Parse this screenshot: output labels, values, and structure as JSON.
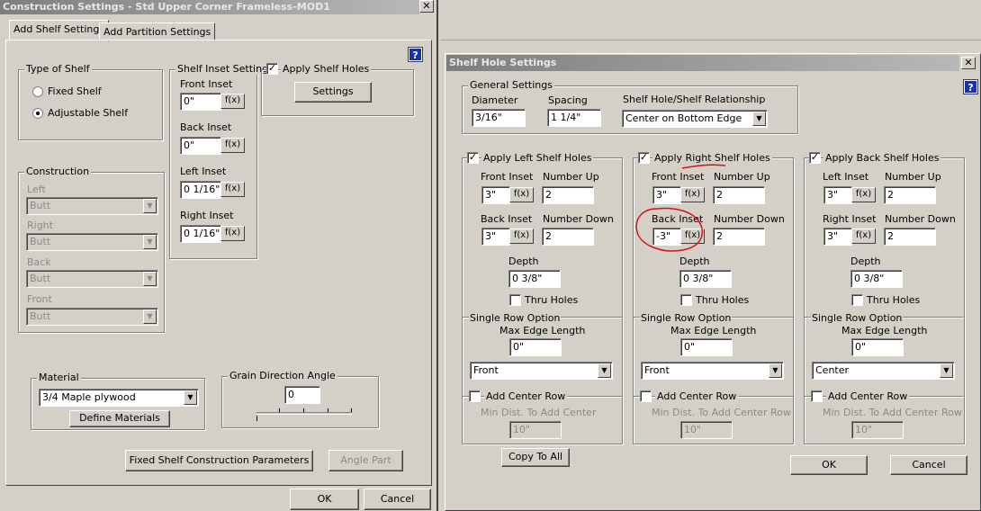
{
  "left_dialog": {
    "title": "Construction Settings - Std Upper Corner Frameless-MOD1",
    "tabs": [
      "Add Shelf Settings",
      "Add Partition Settings"
    ],
    "help": "?",
    "type_of_shelf": {
      "legend": "Type of Shelf",
      "fixed": "Fixed Shelf",
      "adjustable": "Adjustable Shelf",
      "selected": "Adjustable Shelf"
    },
    "shelf_inset": {
      "legend": "Shelf Inset Settings",
      "front_label": "Front Inset",
      "front_value": "0\"",
      "back_label": "Back Inset",
      "back_value": "0\"",
      "left_label": "Left Inset",
      "left_value": "0 1/16\"",
      "right_label": "Right Inset",
      "right_value": "0 1/16\"",
      "fx": "f(x)"
    },
    "apply_shelf_holes": {
      "label": "Apply Shelf Holes",
      "checked": true,
      "settings_button": "Settings"
    },
    "construction": {
      "legend": "Construction",
      "left_label": "Left",
      "left_value": "Butt",
      "right_label": "Right",
      "right_value": "Butt",
      "back_label": "Back",
      "back_value": "Butt",
      "front_label": "Front",
      "front_value": "Butt"
    },
    "material": {
      "legend": "Material",
      "value": "3/4 Maple plywood",
      "define_button": "Define Materials"
    },
    "grain": {
      "legend": "Grain Direction Angle",
      "value": "0"
    },
    "fixed_params_button": "Fixed Shelf Construction Parameters",
    "angle_part_button": "Angle Part",
    "ok": "OK",
    "cancel": "Cancel"
  },
  "right_dialog": {
    "title": "Shelf Hole Settings",
    "help": "?",
    "general": {
      "legend": "General Settings",
      "diameter_label": "Diameter",
      "diameter_value": "3/16\"",
      "spacing_label": "Spacing",
      "spacing_value": "1 1/4\"",
      "relationship_label": "Shelf Hole/Shelf Relationship",
      "relationship_value": "Center on Bottom Edge"
    },
    "panels": [
      {
        "legend": "Apply Left Shelf Holes",
        "checked": true,
        "inset1_label": "Front Inset",
        "inset1_value": "3\"",
        "inset2_label": "Back Inset",
        "inset2_value": "3\"",
        "up_label": "Number Up",
        "up_value": "2",
        "down_label": "Number Down",
        "down_value": "2",
        "depth_label": "Depth",
        "depth_value": "0 3/8\"",
        "thru_label": "Thru Holes",
        "single_row_legend": "Single Row Option",
        "max_edge_label": "Max Edge Length",
        "max_edge_value": "0\"",
        "position_value": "Front",
        "center_row_label": "Add Center Row",
        "min_dist_label": "Min Dist. To Add Center",
        "min_dist_value": "10\""
      },
      {
        "legend": "Apply Right Shelf Holes",
        "checked": true,
        "inset1_label": "Front Inset",
        "inset1_value": "3\"",
        "inset2_label": "Back Inset",
        "inset2_value": "-3\"",
        "up_label": "Number Up",
        "up_value": "2",
        "down_label": "Number Down",
        "down_value": "2",
        "depth_label": "Depth",
        "depth_value": "0 3/8\"",
        "thru_label": "Thru Holes",
        "single_row_legend": "Single Row Option",
        "max_edge_label": "Max Edge Length",
        "max_edge_value": "0\"",
        "position_value": "Front",
        "center_row_label": "Add Center Row",
        "min_dist_label": "Min Dist. To Add Center Row",
        "min_dist_value": "10\""
      },
      {
        "legend": "Apply Back Shelf Holes",
        "checked": true,
        "inset1_label": "Left Inset",
        "inset1_value": "3\"",
        "inset2_label": "Right Inset",
        "inset2_value": "3\"",
        "up_label": "Number Up",
        "up_value": "2",
        "down_label": "Number Down",
        "down_value": "2",
        "depth_label": "Depth",
        "depth_value": "0 3/8\"",
        "thru_label": "Thru Holes",
        "single_row_legend": "Single Row Option",
        "max_edge_label": "Max Edge Length",
        "max_edge_value": "0\"",
        "position_value": "Center",
        "center_row_label": "Add Center Row",
        "min_dist_label": "Min Dist. To Add Center Row",
        "min_dist_value": "10\""
      }
    ],
    "fx": "f(x)",
    "copy_button": "Copy To All",
    "ok": "OK",
    "cancel": "Cancel"
  },
  "colors": {
    "annotation": "#d81010",
    "help_blue": "#1a32a8",
    "dialog_bg": "#d4d0c8"
  }
}
